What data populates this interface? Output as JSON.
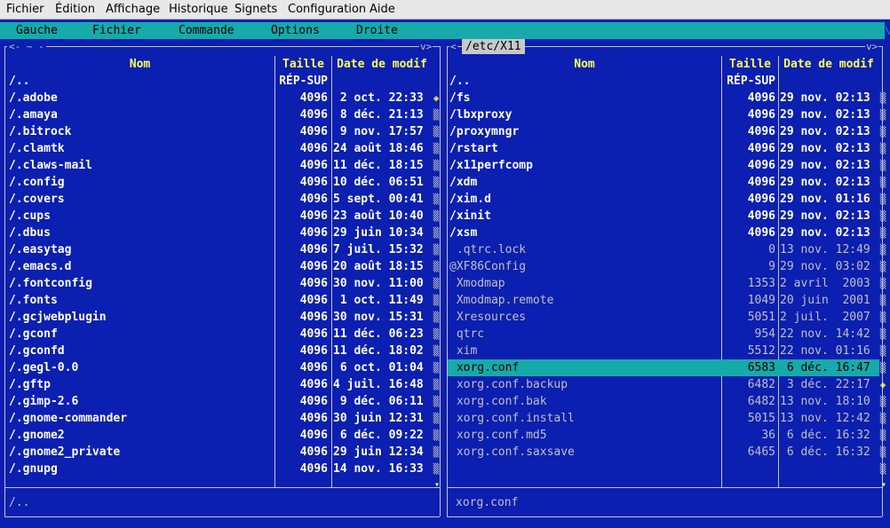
{
  "window_menu": [
    "Fichier",
    "Édition",
    "Affichage",
    "Historique",
    "Signets",
    "Configuration",
    "Aide"
  ],
  "mc_menu": [
    "Gauche",
    "Fichier",
    "Commande",
    "Options",
    "Droite"
  ],
  "columns": {
    "name": "Nom",
    "size": "Taille",
    "date": "Date de modif"
  },
  "left": {
    "hotlist": "<- ~ -",
    "corner": ".[^]>",
    "rows": [
      {
        "name": "/..",
        "size": "RÉP-SUP",
        "date": "",
        "type": "dir"
      },
      {
        "name": "/.adobe",
        "size": "4096",
        "date": " 2 oct. 22:33",
        "type": "dir"
      },
      {
        "name": "/.amaya",
        "size": "4096",
        "date": " 8 déc. 21:13",
        "type": "dir"
      },
      {
        "name": "/.bitrock",
        "size": "4096",
        "date": " 9 nov. 17:57",
        "type": "dir"
      },
      {
        "name": "/.clamtk",
        "size": "4096",
        "date": "24 août 18:46",
        "type": "dir"
      },
      {
        "name": "/.claws-mail",
        "size": "4096",
        "date": "11 déc. 18:15",
        "type": "dir"
      },
      {
        "name": "/.config",
        "size": "4096",
        "date": "10 déc. 06:51",
        "type": "dir"
      },
      {
        "name": "/.covers",
        "size": "4096",
        "date": "5 sept. 00:41",
        "type": "dir"
      },
      {
        "name": "/.cups",
        "size": "4096",
        "date": "23 août 10:40",
        "type": "dir"
      },
      {
        "name": "/.dbus",
        "size": "4096",
        "date": "29 juin 10:34",
        "type": "dir"
      },
      {
        "name": "/.easytag",
        "size": "4096",
        "date": "7 juil. 15:32",
        "type": "dir"
      },
      {
        "name": "/.emacs.d",
        "size": "4096",
        "date": "20 août 18:15",
        "type": "dir"
      },
      {
        "name": "/.fontconfig",
        "size": "4096",
        "date": "30 nov. 11:00",
        "type": "dir"
      },
      {
        "name": "/.fonts",
        "size": "4096",
        "date": " 1 oct. 11:49",
        "type": "dir"
      },
      {
        "name": "/.gcjwebplugin",
        "size": "4096",
        "date": "30 nov. 15:31",
        "type": "dir"
      },
      {
        "name": "/.gconf",
        "size": "4096",
        "date": "11 déc. 06:23",
        "type": "dir"
      },
      {
        "name": "/.gconfd",
        "size": "4096",
        "date": "11 déc. 18:02",
        "type": "dir"
      },
      {
        "name": "/.gegl-0.0",
        "size": "4096",
        "date": " 6 oct. 01:04",
        "type": "dir"
      },
      {
        "name": "/.gftp",
        "size": "4096",
        "date": "4 juil. 16:48",
        "type": "dir"
      },
      {
        "name": "/.gimp-2.6",
        "size": "4096",
        "date": " 9 déc. 06:11",
        "type": "dir"
      },
      {
        "name": "/.gnome-commander",
        "size": "4096",
        "date": "30 juin 12:31",
        "type": "dir"
      },
      {
        "name": "/.gnome2",
        "size": "4096",
        "date": " 6 déc. 09:22",
        "type": "dir"
      },
      {
        "name": "/.gnome2_private",
        "size": "4096",
        "date": "29 juin 12:34",
        "type": "dir"
      },
      {
        "name": "/.gnupg",
        "size": "4096",
        "date": "14 nov. 16:33",
        "type": "dir"
      }
    ],
    "status": "/.."
  },
  "right": {
    "path": "/etc/X11",
    "corner": ".[^]>",
    "rows": [
      {
        "name": "/..",
        "size": "RÉP-SUP",
        "date": "",
        "type": "dir"
      },
      {
        "name": "/fs",
        "size": "4096",
        "date": "29 nov. 02:13",
        "type": "dir"
      },
      {
        "name": "/lbxproxy",
        "size": "4096",
        "date": "29 nov. 02:13",
        "type": "dir"
      },
      {
        "name": "/proxymngr",
        "size": "4096",
        "date": "29 nov. 02:13",
        "type": "dir"
      },
      {
        "name": "/rstart",
        "size": "4096",
        "date": "29 nov. 02:13",
        "type": "dir"
      },
      {
        "name": "/x11perfcomp",
        "size": "4096",
        "date": "29 nov. 02:13",
        "type": "dir"
      },
      {
        "name": "/xdm",
        "size": "4096",
        "date": "29 nov. 02:13",
        "type": "dir"
      },
      {
        "name": "/xim.d",
        "size": "4096",
        "date": "29 nov. 01:16",
        "type": "dir"
      },
      {
        "name": "/xinit",
        "size": "4096",
        "date": "29 nov. 02:13",
        "type": "dir"
      },
      {
        "name": "/xsm",
        "size": "4096",
        "date": "29 nov. 02:13",
        "type": "dir"
      },
      {
        "name": " .qtrc.lock",
        "size": "0",
        "date": "13 nov. 12:49",
        "type": "file"
      },
      {
        "name": "@XF86Config",
        "size": "9",
        "date": "29 nov. 03:02",
        "type": "file"
      },
      {
        "name": " Xmodmap",
        "size": "1353",
        "date": "2 avril  2003",
        "type": "file"
      },
      {
        "name": " Xmodmap.remote",
        "size": "1049",
        "date": "20 juin  2001",
        "type": "file"
      },
      {
        "name": " Xresources",
        "size": "5051",
        "date": "2 juil.  2007",
        "type": "file"
      },
      {
        "name": " qtrc",
        "size": "954",
        "date": "22 nov. 14:42",
        "type": "file"
      },
      {
        "name": " xim",
        "size": "5512",
        "date": "22 nov. 01:16",
        "type": "file"
      },
      {
        "name": " xorg.conf",
        "size": "6583",
        "date": " 6 déc. 16:47",
        "type": "file",
        "selected": true
      },
      {
        "name": " xorg.conf.backup",
        "size": "6482",
        "date": " 3 déc. 22:17",
        "type": "file"
      },
      {
        "name": " xorg.conf.bak",
        "size": "6482",
        "date": "13 nov. 18:10",
        "type": "file"
      },
      {
        "name": " xorg.conf.install",
        "size": "5015",
        "date": "13 nov. 12:42",
        "type": "file"
      },
      {
        "name": " xorg.conf.md5",
        "size": "36",
        "date": " 6 déc. 16:32",
        "type": "file"
      },
      {
        "name": " xorg.conf.saxsave",
        "size": "6465",
        "date": " 6 déc. 16:32",
        "type": "file"
      }
    ],
    "status": " xorg.conf"
  },
  "scroll": {
    "left_thumb_row": 1,
    "right_thumb_row": 18,
    "thumb_glyph": "◈",
    "track_glyph": "▒",
    "down_glyph": "▾"
  }
}
